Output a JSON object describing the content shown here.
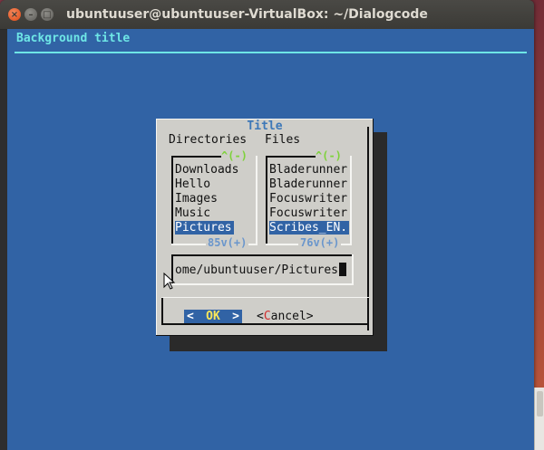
{
  "window": {
    "title": "ubuntuuser@ubuntuuser-VirtualBox: ~/Dialogcode",
    "close_glyph": "×",
    "minimize_glyph": "–",
    "maximize_glyph": "□"
  },
  "terminal": {
    "background_title": "Background title",
    "colors": {
      "background": "#3163a5",
      "title": "#6ee6e6"
    }
  },
  "dialog": {
    "title": "Title",
    "directories_label": "Directories",
    "files_label": "Files",
    "directories": {
      "scroll_up": "^(-)",
      "scroll_down": "85v(+)",
      "items": [
        "Downloads",
        "Hello",
        "Images",
        "Music",
        "Pictures"
      ],
      "selected_index": 4
    },
    "files": {
      "scroll_up": "^(-)",
      "scroll_down": "76v(+)",
      "items": [
        "Bladerunner",
        "Bladerunner",
        "Focuswriter",
        "Focuswriter",
        "Scribes_EN."
      ],
      "selected_index": 4
    },
    "path_value": "ome/ubuntuuser/Pictures",
    "buttons": {
      "ok_left": "<",
      "ok_label": "OK",
      "ok_right": ">",
      "cancel_open": "<",
      "cancel_hotkey": "C",
      "cancel_rest": "ancel>"
    }
  }
}
